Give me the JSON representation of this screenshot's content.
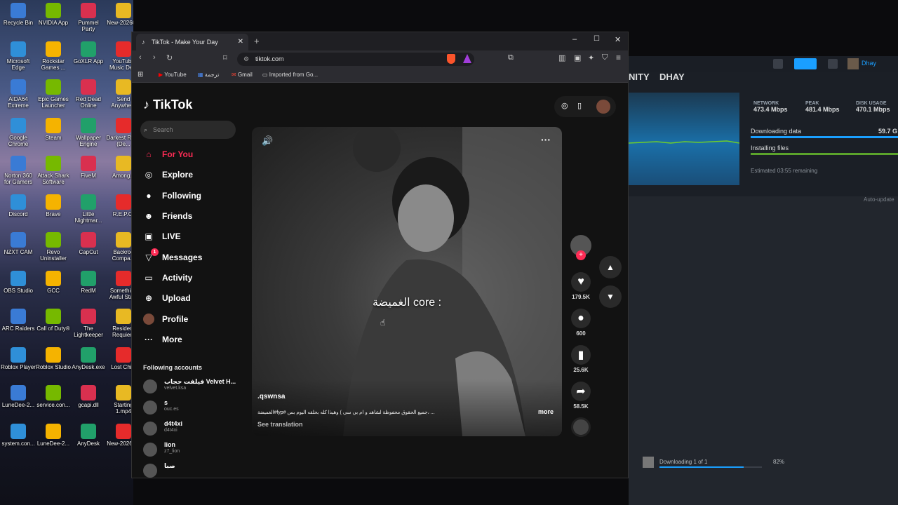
{
  "desktop": {
    "icons": [
      "Recycle Bin",
      "NVIDIA App",
      "Pummel Party",
      "New-20260...",
      "Microsoft Edge",
      "Rockstar Games ...",
      "GoXLR App",
      "YouTube Music De...",
      "AIDA64 Extreme",
      "Epic Games Launcher",
      "Red Dead Online",
      "Send Anywhe...",
      "Google Chrome",
      "Steam",
      "Wallpaper Engine",
      "Darkest Road (De...",
      "Norton 360 for Gamers",
      "Attack Shark Software",
      "FiveM",
      "Among...",
      "Discord",
      "Brave",
      "Little Nightmar...",
      "R.E.P.O.",
      "NZXT CAM",
      "Revo Uninstaller",
      "CapCut",
      "Backroo Compa...",
      "OBS Studio",
      "GCC",
      "RedM",
      "Something Awful Sta...",
      "ARC Raiders",
      "Call of Duty®",
      "The Lightkeeper",
      "Resident Requiem",
      "Roblox Player",
      "Roblox Studio",
      "AnyDesk.exe",
      "Lost Child",
      "LuneDee-2...",
      "service.con...",
      "gcapi.dll",
      "Starting 1.mp4",
      "system.con...",
      "LuneDee-2...",
      "AnyDesk",
      "New-20260..."
    ]
  },
  "steam": {
    "partial_title": "NITY",
    "user_title": "DHAY",
    "account_name": "Dhay",
    "network_label": "NETWORK",
    "network_value": "473.4 Mbps",
    "peak_label": "PEAK",
    "peak_value": "481.4 Mbps",
    "disk_label": "DISK USAGE",
    "disk_value": "470.1 Mbps",
    "downloading_data": "Downloading data",
    "downloading_size": "59.7 G",
    "installing_files": "Installing files",
    "estimate": "Estimated 03:55 remaining",
    "auto_update": "Auto-update",
    "footer_status": "Downloading 1 of 1",
    "footer_percent": "82%",
    "footer_progress": 0.82
  },
  "browser": {
    "tab_title": "TikTok - Make Your Day",
    "url": "tiktok.com",
    "bookmarks": [
      "YouTube",
      "ترجمة",
      "Gmail",
      "Imported from Go..."
    ]
  },
  "tiktok": {
    "logo": "TikTok",
    "search_placeholder": "Search",
    "nav": [
      {
        "label": "For You",
        "icon": "home-icon",
        "active": true
      },
      {
        "label": "Explore",
        "icon": "compass-icon"
      },
      {
        "label": "Following",
        "icon": "following-icon"
      },
      {
        "label": "Friends",
        "icon": "friends-icon"
      },
      {
        "label": "LIVE",
        "icon": "live-icon"
      },
      {
        "label": "Messages",
        "icon": "messages-icon",
        "badge": "1"
      },
      {
        "label": "Activity",
        "icon": "activity-icon"
      },
      {
        "label": "Upload",
        "icon": "upload-icon"
      },
      {
        "label": "Profile",
        "icon": "profile-icon"
      },
      {
        "label": "More",
        "icon": "more-icon"
      }
    ],
    "following_title": "Following accounts",
    "accounts": [
      {
        "name": "فيلفت حجاب Velvet H...",
        "handle": "velvet.ksa"
      },
      {
        "name": "s",
        "handle": "ouc.es"
      },
      {
        "name": "d4t4xi",
        "handle": "d4t4xi"
      },
      {
        "name": "lion",
        "handle": "z7_lion"
      },
      {
        "name": "صبا",
        "handle": ""
      }
    ],
    "video": {
      "caption": "الغميضة core :",
      "username": ".qswnsa",
      "description": "الغميضة#fyp# جميع الحقوق محفوظة لشاهد و ام بي سي ) وهيذا كله بحلقه اليوم بس، ...",
      "more": "more",
      "see_translation": "See translation",
      "likes": "179.5K",
      "comments": "600",
      "saves": "25.6K",
      "shares": "58.5K"
    }
  }
}
